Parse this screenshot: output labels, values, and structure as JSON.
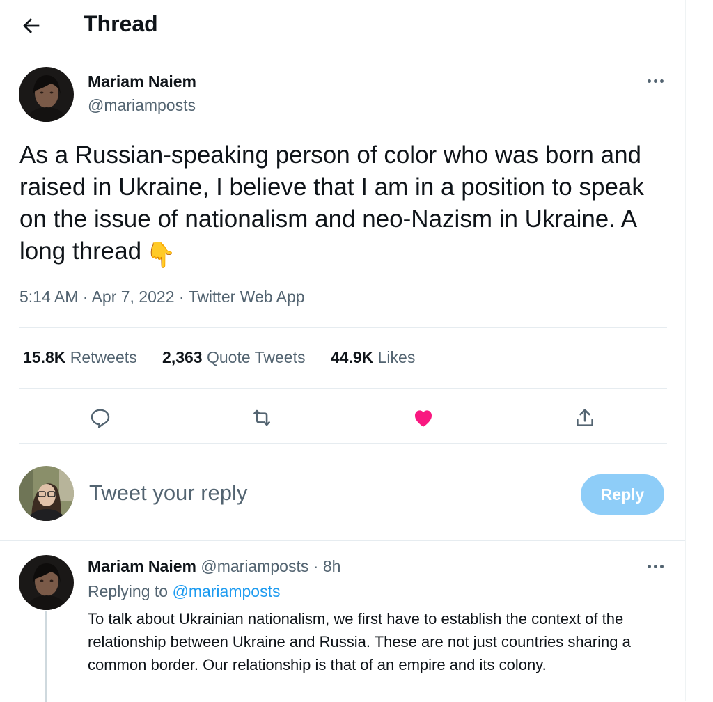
{
  "header": {
    "title": "Thread",
    "back_icon": "arrow-left-icon"
  },
  "tweet": {
    "author_name": "Mariam Naiem",
    "author_handle": "@mariamposts",
    "text": "As a Russian-speaking person of color who was born and raised in Ukraine, I believe that I am in a position to speak on the issue of nationalism and neo-Nazism in Ukraine. A long thread",
    "emoji": "👇",
    "time": "5:14 AM",
    "date": "Apr 7, 2022",
    "source": "Twitter Web App",
    "stats": {
      "retweets_count": "15.8K",
      "retweets_label": "Retweets",
      "quotes_count": "2,363",
      "quotes_label": "Quote Tweets",
      "likes_count": "44.9K",
      "likes_label": "Likes"
    },
    "liked": true
  },
  "reply_box": {
    "placeholder": "Tweet your reply",
    "button_label": "Reply"
  },
  "reply": {
    "author_name": "Mariam Naiem",
    "author_handle": "@mariamposts",
    "time_ago": "8h",
    "replying_prefix": "Replying to",
    "replying_to": "@mariamposts",
    "text": "To talk about Ukrainian nationalism, we first have to establish the context of the relationship between Ukraine and Russia. These are not just countries sharing a common border. Our relationship is that of an empire and its colony."
  },
  "colors": {
    "accent": "#1d9bf0",
    "like": "#f91880",
    "muted": "#536471",
    "reply_button": "#8ecdf8"
  }
}
